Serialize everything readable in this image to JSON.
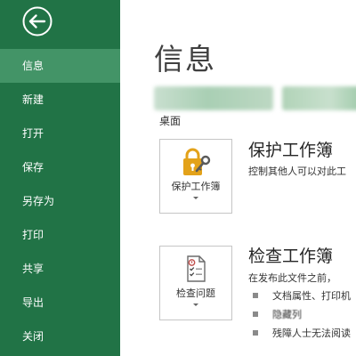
{
  "sidebar": {
    "back_icon": "back-arrow-circle-icon",
    "items": [
      {
        "label": "信息",
        "active": true
      },
      {
        "label": "新建",
        "active": false
      },
      {
        "label": "打开",
        "active": false
      },
      {
        "label": "保存",
        "active": false
      },
      {
        "label": "另存为",
        "active": false
      },
      {
        "label": "打印",
        "active": false
      },
      {
        "label": "共享",
        "active": false
      },
      {
        "label": "导出",
        "active": false
      },
      {
        "label": "关闭",
        "active": false
      }
    ]
  },
  "main": {
    "title": "信息",
    "location": "桌面",
    "protect": {
      "button_label": "保护工作簿",
      "icon": "lock-key-icon",
      "title": "保护工作簿",
      "description": "控制其他人可以对此工"
    },
    "inspect": {
      "button_label": "检查问题",
      "icon": "checklist-document-icon",
      "title": "检查工作簿",
      "description": "在发布此文件之前，",
      "bullets": [
        "文档属性、打印机",
        "隐藏列",
        "残障人士无法阅读"
      ]
    }
  },
  "colors": {
    "sidebar_bg": "#217346",
    "sidebar_active": "#439467",
    "text_main": "#404040",
    "lock_gold": "#e3a21a"
  }
}
